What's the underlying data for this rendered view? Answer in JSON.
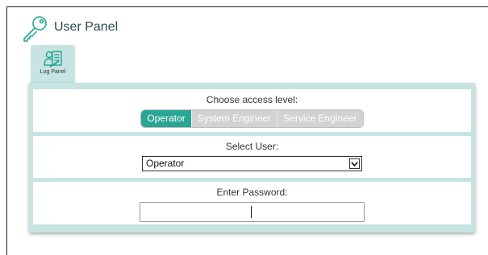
{
  "header": {
    "title": "User Panel",
    "icon": "key-icon"
  },
  "tabs": [
    {
      "label": "Log Panel",
      "icon": "user-list-icon",
      "active": true
    }
  ],
  "access_level": {
    "label": "Choose access level:",
    "options": [
      "Operator",
      "System Engineer",
      "Service Engineer"
    ],
    "selected": "Operator",
    "accent_color": "#28a593"
  },
  "user_select": {
    "label": "Select User:",
    "value": "Operator"
  },
  "password": {
    "label": "Enter Password:",
    "value": ""
  },
  "colors": {
    "panel_bg": "#c6e4e1",
    "inactive_segment": "#d2d2d2"
  }
}
